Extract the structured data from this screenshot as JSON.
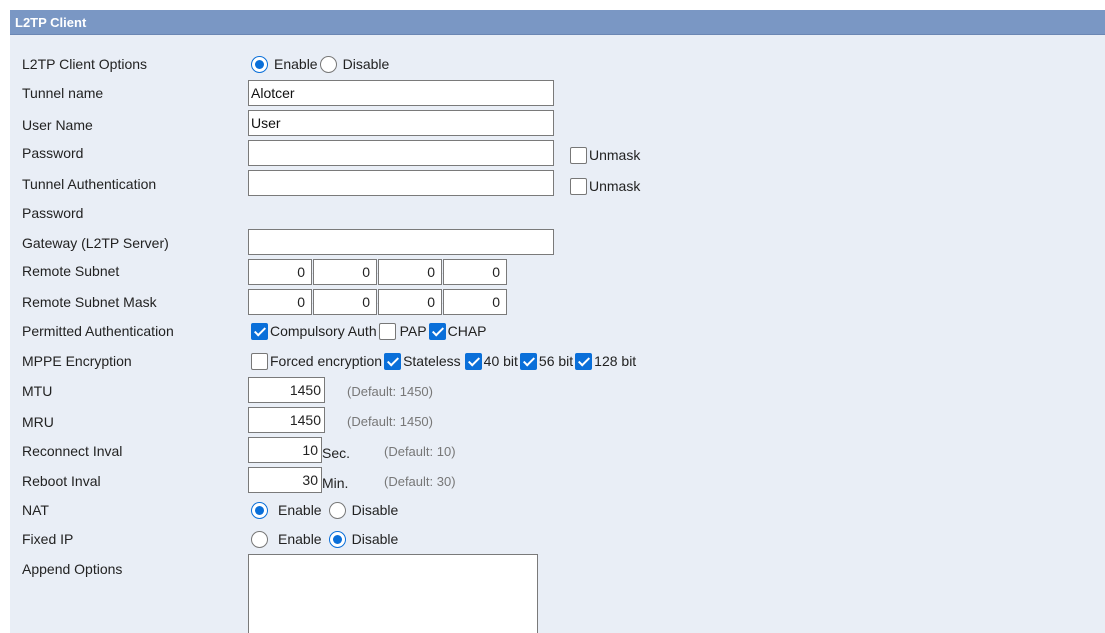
{
  "header": {
    "title": "L2TP Client"
  },
  "labels": {
    "client_options": "L2TP Client Options",
    "tunnel_name": "Tunnel name",
    "user_name": "User Name",
    "password": "Password",
    "tunnel_auth_line1": "Tunnel Authentication",
    "tunnel_auth_line2": "Password",
    "gateway": "Gateway (L2TP Server)",
    "remote_subnet": "Remote Subnet",
    "remote_subnet_mask": "Remote Subnet Mask",
    "permitted_auth": "Permitted Authentication",
    "mppe": "MPPE Encryption",
    "mtu": "MTU",
    "mru": "MRU",
    "reconnect": "Reconnect Inval",
    "reboot": "Reboot Inval",
    "nat": "NAT",
    "fixed_ip": "Fixed IP",
    "append": "Append Options"
  },
  "client_options": {
    "enable": "Enable",
    "disable": "Disable",
    "selected": "Enable"
  },
  "fields": {
    "tunnel_name": "Alotcer",
    "user_name": "User",
    "password": "",
    "tunnel_auth_password": "",
    "gateway": "",
    "append_options": ""
  },
  "unmask": {
    "label": "Unmask"
  },
  "remote_subnet": [
    "0",
    "0",
    "0",
    "0"
  ],
  "remote_subnet_mask": [
    "0",
    "0",
    "0",
    "0"
  ],
  "permitted_auth": {
    "compulsory": {
      "label": "Compulsory Auth",
      "checked": true
    },
    "pap": {
      "label": "PAP",
      "checked": false
    },
    "chap": {
      "label": "CHAP",
      "checked": true
    }
  },
  "mppe": {
    "forced": {
      "label": "Forced encryption",
      "checked": false
    },
    "stateless": {
      "label": "Stateless",
      "checked": true
    },
    "bit40": {
      "label": "40 bit",
      "checked": true
    },
    "bit56": {
      "label": "56 bit",
      "checked": true
    },
    "bit128": {
      "label": "128 bit",
      "checked": true
    }
  },
  "mtu": {
    "value": "1450",
    "hint": "(Default: 1450)"
  },
  "mru": {
    "value": "1450",
    "hint": "(Default: 1450)"
  },
  "reconnect": {
    "value": "10",
    "unit": "Sec.",
    "hint": "(Default: 10)"
  },
  "reboot": {
    "value": "30",
    "unit": "Min.",
    "hint": "(Default: 30)"
  },
  "nat": {
    "enable": "Enable",
    "disable": "Disable",
    "selected": "Enable"
  },
  "fixed_ip": {
    "enable": "Enable",
    "disable": "Disable",
    "selected": "Disable"
  },
  "colors": {
    "header_bg": "#7a97c4",
    "panel_bg": "#e9eef6",
    "accent": "#0a6fd9"
  }
}
